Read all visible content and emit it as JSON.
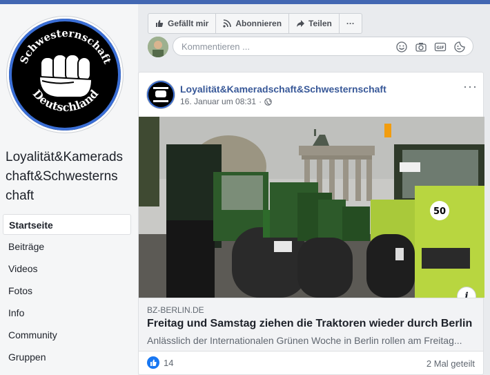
{
  "page": {
    "name": "Loyalität&Kameradschaft&Schwesternschaft",
    "name_lines": [
      "Loyalität&Kamerads",
      "chaft&Schwesterns",
      "chaft"
    ],
    "logo_text_top": "Schwesternschaft",
    "logo_text_bottom": "Deutschland"
  },
  "nav": [
    {
      "label": "Startseite",
      "active": true
    },
    {
      "label": "Beiträge"
    },
    {
      "label": "Videos"
    },
    {
      "label": "Fotos"
    },
    {
      "label": "Info"
    },
    {
      "label": "Community"
    },
    {
      "label": "Gruppen"
    }
  ],
  "actions": {
    "like": "Gefällt mir",
    "subscribe": "Abonnieren",
    "share": "Teilen",
    "more": "···"
  },
  "comment": {
    "placeholder": "Kommentieren ..."
  },
  "post": {
    "author": "Loyalität&Kameradschaft&Schwesternschaft",
    "date": "16. Januar um 08:31",
    "separator": "·",
    "more": "···",
    "image_alt": "Tractors at Brandenburg Gate",
    "plate_number": "50",
    "info_glyph": "i",
    "link": {
      "domain": "BZ-BERLIN.DE",
      "title": "Freitag und Samstag ziehen die Traktoren wieder durch Berlin",
      "description": "Anlässlich der Internationalen Grünen Woche in Berlin rollen am Freitag..."
    },
    "reactions_count": "14",
    "shares": "2 Mal geteilt"
  },
  "colors": {
    "brand": "#4267b2",
    "link": "#385898",
    "like": "#1877f2"
  }
}
